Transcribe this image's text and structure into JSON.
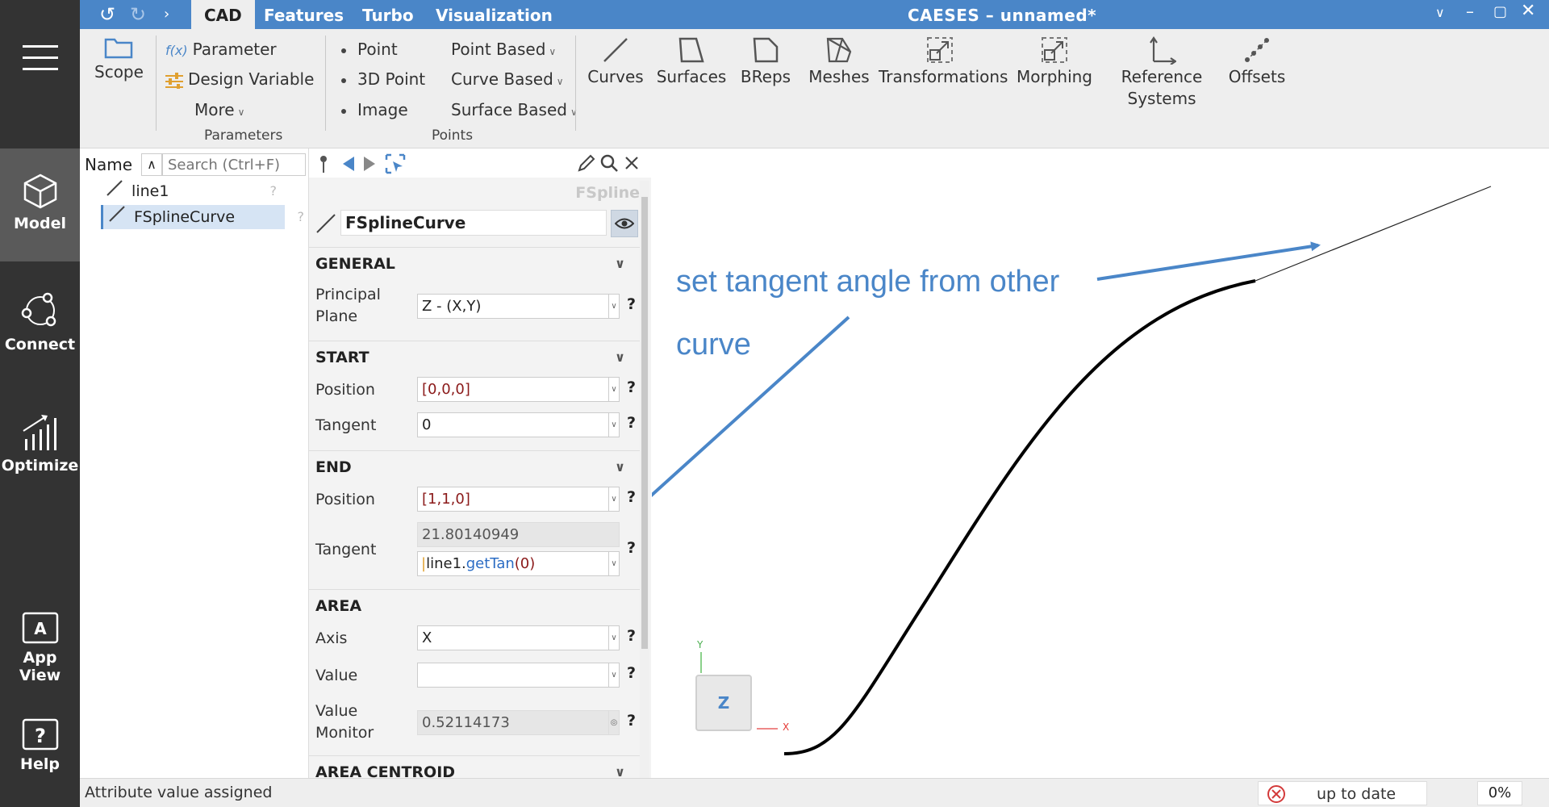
{
  "app": {
    "title": "CAESES – unnamed*"
  },
  "tabs": [
    {
      "label": "CAD",
      "active": true
    },
    {
      "label": "Features"
    },
    {
      "label": "Turbo"
    },
    {
      "label": "Visualization"
    }
  ],
  "sidebar": {
    "items": [
      {
        "label": "Model",
        "icon": "cube-icon",
        "active": true
      },
      {
        "label": "Connect",
        "icon": "connect-icon"
      },
      {
        "label": "Optimize",
        "icon": "chart-icon"
      },
      {
        "label": "App View",
        "icon": "appview-icon"
      },
      {
        "label": "Help",
        "icon": "help-icon"
      }
    ]
  },
  "ribbon": {
    "scope": "Scope",
    "parameter": "Parameter",
    "parameter_prefix": "f(x)",
    "design_variable": "Design Variable",
    "more": "More",
    "group_parameters": "Parameters",
    "point": "Point",
    "point3d": "3D Point",
    "image": "Image",
    "point_based": "Point Based",
    "curve_based": "Curve Based",
    "surface_based": "Surface Based",
    "group_points": "Points",
    "curves": "Curves",
    "surfaces": "Surfaces",
    "breps": "BReps",
    "meshes": "Meshes",
    "transformations": "Transformations",
    "morphing": "Morphing",
    "reference_systems_line1": "Reference",
    "reference_systems_line2": "Systems",
    "offsets": "Offsets"
  },
  "tree": {
    "header": "Name",
    "search_placeholder": "Search (Ctrl+F)",
    "items": [
      {
        "label": "line1",
        "selected": false
      },
      {
        "label": "FSplineCurve",
        "selected": true
      }
    ],
    "help": "?"
  },
  "properties": {
    "type_name": "FSpline",
    "object_name": "FSplineCurve",
    "general": {
      "title": "GENERAL",
      "principal_plane_label_1": "Principal",
      "principal_plane_label_2": "Plane",
      "principal_plane_value": "Z - (X,Y)"
    },
    "start": {
      "title": "START",
      "position_label": "Position",
      "position_value": "[0,0,0]",
      "tangent_label": "Tangent",
      "tangent_value": "0"
    },
    "end": {
      "title": "END",
      "position_label": "Position",
      "position_value": "[1,1,0]",
      "tangent_label": "Tangent",
      "tangent_computed": "21.80140949",
      "tangent_expr_obj": "line1",
      "tangent_expr_dot": ".",
      "tangent_expr_fn": "getTan",
      "tangent_expr_args": "(0)"
    },
    "area": {
      "title": "AREA",
      "axis_label": "Axis",
      "axis_value": "X",
      "value_label": "Value",
      "value_value": "",
      "monitor_label_1": "Value",
      "monitor_label_2": "Monitor",
      "monitor_value": "0.52114173"
    },
    "area_centroid": {
      "title": "AREA CENTROID"
    },
    "help": "?"
  },
  "viewport": {
    "annotation_line1": "set tangent angle from other",
    "annotation_line2": "curve",
    "cube_label": "Z",
    "axis_y": "Y",
    "axis_x": "X"
  },
  "status": {
    "message": "Attribute value assigned",
    "state": "up to date",
    "progress": "0%"
  },
  "colors": {
    "accent": "#4a86c8",
    "sidebar": "#333333",
    "ribbon": "#eeeeee",
    "error": "#d33a3a"
  }
}
